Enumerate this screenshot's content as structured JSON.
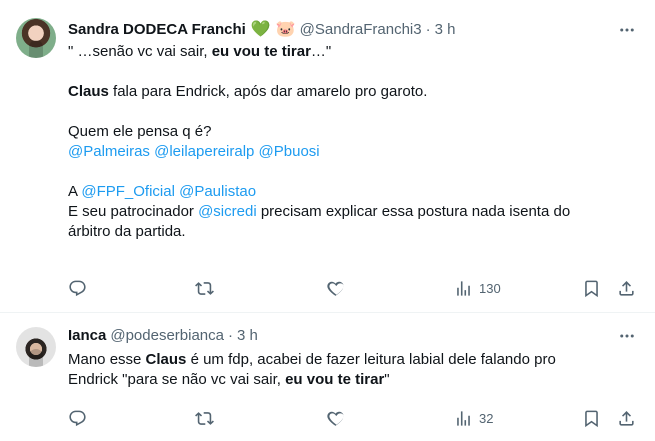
{
  "tweets": [
    {
      "author": {
        "name": "Sandra DODECA Franchi",
        "emoji1": "💚",
        "emoji2": "🐷",
        "handle": "@SandraFranchi3",
        "dot": "·",
        "time": "3 h"
      },
      "lines": {
        "l1a": "\" …senão vc vai sair, ",
        "l1b": "eu vou te tirar",
        "l1c": "…\"",
        "l2a": "Claus",
        "l2b": " fala para Endrick, após dar amarelo pro garoto.",
        "l3": "Quem ele pensa q é?",
        "m1": "@Palmeiras",
        "m2": "@leilapereiralp",
        "m3": "@Pbuosi",
        "l5a": "A ",
        "m4": "@FPF_Oficial",
        "m5": "@Paulistao",
        "l6a": "E seu patrocinador ",
        "m6": "@sicredi",
        "l6b": " precisam explicar essa postura nada isenta do",
        "l7": "árbitro da partida."
      },
      "actions": {
        "views": "130"
      }
    },
    {
      "author": {
        "name": "Ianca",
        "handle": "@podeserbianca",
        "dot": "·",
        "time": "3 h"
      },
      "lines": {
        "l1a": "Mano esse ",
        "l1b": "Claus",
        "l1c": " é  um fdp, acabei de fazer leitura labial dele falando pro",
        "l2a": "Endrick \"para se não vc vai sair, ",
        "l2b": "eu vou te tirar",
        "l2c": "\""
      },
      "actions": {
        "views": "32"
      }
    }
  ],
  "icons": {
    "more": "more-horizontal-icon",
    "reply": "reply-icon",
    "retweet": "retweet-icon",
    "like": "heart-icon",
    "views": "views-chart-icon",
    "bookmark": "bookmark-icon",
    "share": "share-icon"
  },
  "colors": {
    "link": "#1d9bf0",
    "muted": "#536471",
    "text": "#0f1419",
    "divider": "#eff3f4"
  }
}
